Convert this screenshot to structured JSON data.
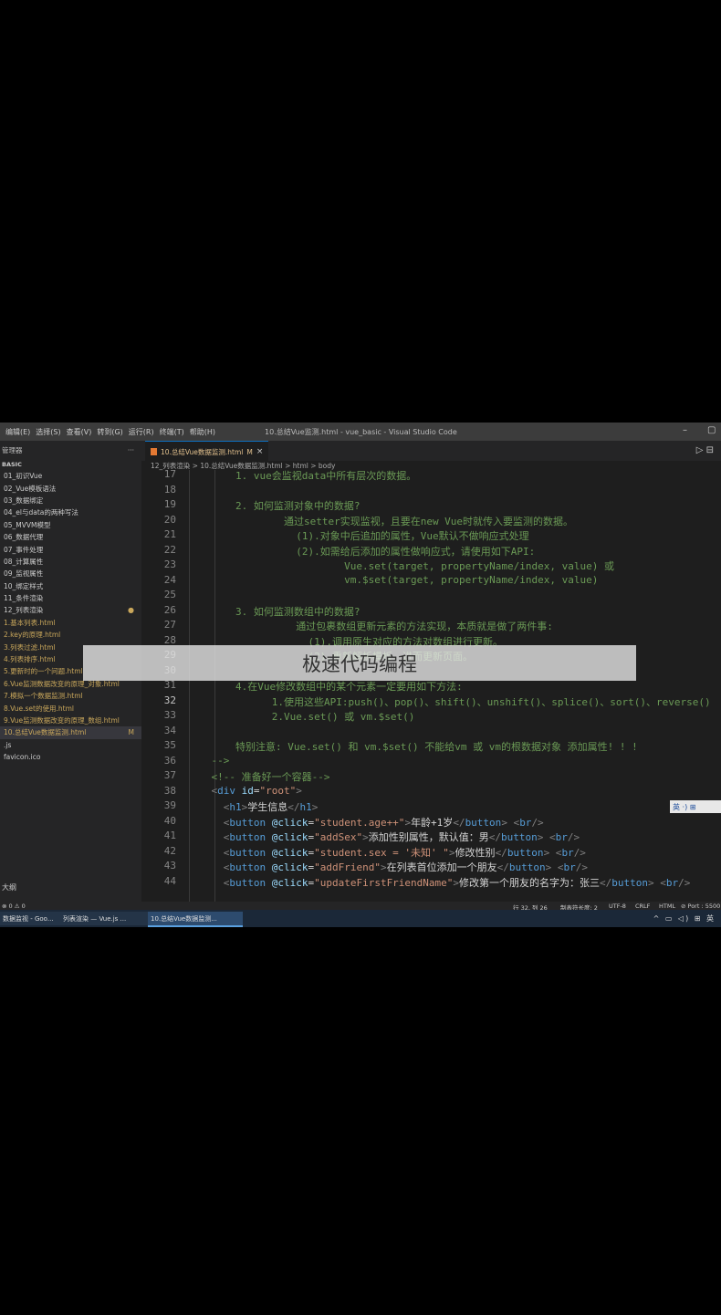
{
  "menu": [
    "编辑(E)",
    "选择(S)",
    "查看(V)",
    "转到(G)",
    "运行(R)",
    "终端(T)",
    "帮助(H)"
  ],
  "window_title": "10.总结Vue监测.html - vue_basic - Visual Studio Code",
  "window_controls": [
    "–",
    "▢"
  ],
  "sidebar": {
    "title": "管理器",
    "more": "···",
    "section": "BASIC",
    "items": [
      {
        "label": "01_初识Vue",
        "badge": ""
      },
      {
        "label": "02_Vue模板语法",
        "badge": ""
      },
      {
        "label": "03_数据绑定",
        "badge": ""
      },
      {
        "label": "04_el与data的两种写法",
        "badge": ""
      },
      {
        "label": "05_MVVM模型",
        "badge": ""
      },
      {
        "label": "06_数据代理",
        "badge": ""
      },
      {
        "label": "07_事件处理",
        "badge": ""
      },
      {
        "label": "08_计算属性",
        "badge": ""
      },
      {
        "label": "09_监视属性",
        "badge": ""
      },
      {
        "label": "10_绑定样式",
        "badge": ""
      },
      {
        "label": "11_条件渲染",
        "badge": ""
      },
      {
        "label": "12_列表渲染",
        "badge": "●"
      },
      {
        "label": "1.基本列表.html",
        "badge": ""
      },
      {
        "label": "2.key的原理.html",
        "badge": ""
      },
      {
        "label": "3.列表过滤.html",
        "badge": ""
      },
      {
        "label": "4.列表排序.html",
        "badge": ""
      },
      {
        "label": "5.更新时的一个问题.html",
        "badge": ""
      },
      {
        "label": "6.Vue监测数据改变的原理_对象.html",
        "badge": ""
      },
      {
        "label": "7.模拟一个数据监测.html",
        "badge": ""
      },
      {
        "label": "8.Vue.set的使用.html",
        "badge": ""
      },
      {
        "label": "9.Vue监测数据改变的原理_数组.html",
        "badge": ""
      },
      {
        "label": "10.总结Vue数据监测.html",
        "badge": "M"
      }
    ],
    "extra": [
      ".js",
      "favicon.ico"
    ],
    "bottom": "大纲"
  },
  "tab": {
    "label": "10.总结Vue数据监测.html",
    "modified": "M",
    "close": "×"
  },
  "run_icons": "▷  ⊟",
  "breadcrumb": "12_列表渲染  >  10.总结Vue数据监测.html  >  html  >  body",
  "code_lines": [
    {
      "n": "17",
      "parts": [
        {
          "c": "cmt",
          "t": "        1. vue会监视data中所有层次的数据。"
        }
      ]
    },
    {
      "n": "18",
      "parts": [
        {
          "c": "cmt",
          "t": ""
        }
      ]
    },
    {
      "n": "19",
      "parts": [
        {
          "c": "cmt",
          "t": "        2. 如何监测对象中的数据?"
        }
      ]
    },
    {
      "n": "20",
      "parts": [
        {
          "c": "cmt",
          "t": "                通过setter实现监视，且要在new Vue时就传入要监测的数据。"
        }
      ]
    },
    {
      "n": "21",
      "parts": [
        {
          "c": "cmt",
          "t": "                  (1).对象中后追加的属性，Vue默认不做响应式处理"
        }
      ]
    },
    {
      "n": "22",
      "parts": [
        {
          "c": "cmt",
          "t": "                  (2).如需给后添加的属性做响应式，请使用如下API:"
        }
      ]
    },
    {
      "n": "23",
      "parts": [
        {
          "c": "cmt",
          "t": "                          Vue.set(target, propertyName/index, value) 或"
        }
      ]
    },
    {
      "n": "24",
      "parts": [
        {
          "c": "cmt",
          "t": "                          vm.$set(target, propertyName/index, value)"
        }
      ]
    },
    {
      "n": "25",
      "parts": [
        {
          "c": "cmt",
          "t": ""
        }
      ]
    },
    {
      "n": "26",
      "parts": [
        {
          "c": "cmt",
          "t": "        3. 如何监测数组中的数据?"
        }
      ]
    },
    {
      "n": "27",
      "parts": [
        {
          "c": "cmt",
          "t": "                  通过包裹数组更新元素的方法实现，本质就是做了两件事:"
        }
      ]
    },
    {
      "n": "28",
      "parts": [
        {
          "c": "cmt",
          "t": "                    (1).调用原生对应的方法对数组进行更新。"
        }
      ]
    },
    {
      "n": "29",
      "parts": [
        {
          "c": "cmt",
          "t": "                    (2).重新解析模板，进而更新页面。"
        }
      ]
    },
    {
      "n": "30",
      "parts": [
        {
          "c": "cmt",
          "t": ""
        }
      ]
    },
    {
      "n": "31",
      "parts": [
        {
          "c": "cmt",
          "t": "        4.在Vue修改数组中的某个元素一定要用如下方法:"
        }
      ]
    },
    {
      "n": "32",
      "parts": [
        {
          "c": "cmt",
          "t": "              1.使用这些API:push()、pop()、shift()、unshift()、splice()、sort()、reverse()"
        }
      ]
    },
    {
      "n": "33",
      "parts": [
        {
          "c": "cmt",
          "t": "              2.Vue.set() 或 vm.$set()"
        }
      ]
    },
    {
      "n": "34",
      "parts": [
        {
          "c": "cmt",
          "t": ""
        }
      ]
    },
    {
      "n": "35",
      "parts": [
        {
          "c": "cmt",
          "t": "        特别注意: Vue.set() 和 vm.$set() 不能给vm 或 vm的根数据对象 添加属性! ! !"
        }
      ]
    },
    {
      "n": "36",
      "parts": [
        {
          "c": "cmt",
          "t": "    -->"
        }
      ]
    },
    {
      "n": "37",
      "parts": [
        {
          "c": "cmt",
          "t": "    <!-- 准备好一个容器-->"
        }
      ]
    },
    {
      "n": "38",
      "parts": [
        {
          "c": "pu",
          "t": "    <"
        },
        {
          "c": "tg",
          "t": "div"
        },
        {
          "c": "at",
          "t": " id"
        },
        {
          "c": "tx",
          "t": "="
        },
        {
          "c": "st",
          "t": "\"root\""
        },
        {
          "c": "pu",
          "t": ">"
        }
      ]
    },
    {
      "n": "39",
      "parts": [
        {
          "c": "pu",
          "t": "      <"
        },
        {
          "c": "tg",
          "t": "h1"
        },
        {
          "c": "pu",
          "t": ">"
        },
        {
          "c": "tx",
          "t": "学生信息"
        },
        {
          "c": "pu",
          "t": "</"
        },
        {
          "c": "tg",
          "t": "h1"
        },
        {
          "c": "pu",
          "t": ">"
        }
      ]
    },
    {
      "n": "40",
      "parts": [
        {
          "c": "pu",
          "t": "      <"
        },
        {
          "c": "tg",
          "t": "button"
        },
        {
          "c": "at",
          "t": " @click"
        },
        {
          "c": "tx",
          "t": "="
        },
        {
          "c": "st",
          "t": "\"student.age++\""
        },
        {
          "c": "pu",
          "t": ">"
        },
        {
          "c": "tx",
          "t": "年龄+1岁"
        },
        {
          "c": "pu",
          "t": "</"
        },
        {
          "c": "tg",
          "t": "button"
        },
        {
          "c": "pu",
          "t": "> <"
        },
        {
          "c": "tg",
          "t": "br"
        },
        {
          "c": "pu",
          "t": "/>"
        }
      ]
    },
    {
      "n": "41",
      "parts": [
        {
          "c": "pu",
          "t": "      <"
        },
        {
          "c": "tg",
          "t": "button"
        },
        {
          "c": "at",
          "t": " @click"
        },
        {
          "c": "tx",
          "t": "="
        },
        {
          "c": "st",
          "t": "\"addSex\""
        },
        {
          "c": "pu",
          "t": ">"
        },
        {
          "c": "tx",
          "t": "添加性别属性，默认值：男"
        },
        {
          "c": "pu",
          "t": "</"
        },
        {
          "c": "tg",
          "t": "button"
        },
        {
          "c": "pu",
          "t": "> <"
        },
        {
          "c": "tg",
          "t": "br"
        },
        {
          "c": "pu",
          "t": "/>"
        }
      ]
    },
    {
      "n": "42",
      "parts": [
        {
          "c": "pu",
          "t": "      <"
        },
        {
          "c": "tg",
          "t": "button"
        },
        {
          "c": "at",
          "t": " @click"
        },
        {
          "c": "tx",
          "t": "="
        },
        {
          "c": "st",
          "t": "\"student.sex = '未知' \""
        },
        {
          "c": "pu",
          "t": ">"
        },
        {
          "c": "tx",
          "t": "修改性别"
        },
        {
          "c": "pu",
          "t": "</"
        },
        {
          "c": "tg",
          "t": "button"
        },
        {
          "c": "pu",
          "t": "> <"
        },
        {
          "c": "tg",
          "t": "br"
        },
        {
          "c": "pu",
          "t": "/>"
        }
      ]
    },
    {
      "n": "43",
      "parts": [
        {
          "c": "pu",
          "t": "      <"
        },
        {
          "c": "tg",
          "t": "button"
        },
        {
          "c": "at",
          "t": " @click"
        },
        {
          "c": "tx",
          "t": "="
        },
        {
          "c": "st",
          "t": "\"addFriend\""
        },
        {
          "c": "pu",
          "t": ">"
        },
        {
          "c": "tx",
          "t": "在列表首位添加一个朋友"
        },
        {
          "c": "pu",
          "t": "</"
        },
        {
          "c": "tg",
          "t": "button"
        },
        {
          "c": "pu",
          "t": "> <"
        },
        {
          "c": "tg",
          "t": "br"
        },
        {
          "c": "pu",
          "t": "/>"
        }
      ]
    },
    {
      "n": "44",
      "parts": [
        {
          "c": "pu",
          "t": "      <"
        },
        {
          "c": "tg",
          "t": "button"
        },
        {
          "c": "at",
          "t": " @click"
        },
        {
          "c": "tx",
          "t": "="
        },
        {
          "c": "st",
          "t": "\"updateFirstFriendName\""
        },
        {
          "c": "pu",
          "t": ">"
        },
        {
          "c": "tx",
          "t": "修改第一个朋友的名字为：张三"
        },
        {
          "c": "pu",
          "t": "</"
        },
        {
          "c": "tg",
          "t": "button"
        },
        {
          "c": "pu",
          "t": "> <"
        },
        {
          "c": "tg",
          "t": "br"
        },
        {
          "c": "pu",
          "t": "/>"
        }
      ]
    }
  ],
  "current_line": "32",
  "ime": "英 ·) ⊞",
  "status": {
    "left": "⊗ 0 ⚠ 0",
    "position": "行 32, 列 26",
    "tabsize": "制表符长度: 2",
    "encoding": "UTF-8",
    "eol": "CRLF",
    "lang": "HTML",
    "extra": "⊘ Port : 5500"
  },
  "taskbar": [
    {
      "label": "数据监视 - Goo...",
      "active": false
    },
    {
      "label": "列表渲染 — Vue.js ...",
      "active": false
    },
    {
      "label": "10.总结Vue数据监测...",
      "active": true
    }
  ],
  "tray": "^ ▭ ◁) ⊞ 英",
  "watermark": "极速代码编程"
}
